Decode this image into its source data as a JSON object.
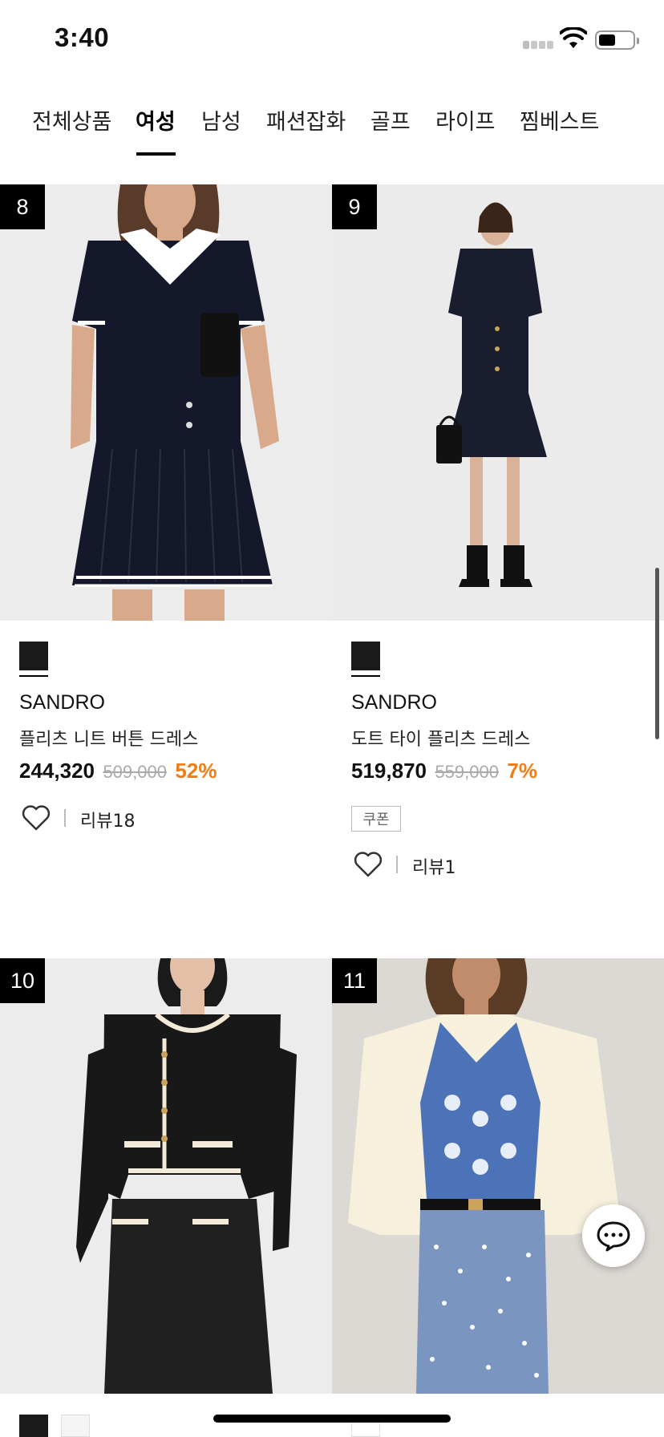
{
  "status_bar": {
    "time": "3:40"
  },
  "tabs": [
    {
      "label": "전체상품"
    },
    {
      "label": "여성",
      "active": true
    },
    {
      "label": "남성"
    },
    {
      "label": "패션잡화"
    },
    {
      "label": "골프"
    },
    {
      "label": "라이프"
    },
    {
      "label": "찜베스트"
    }
  ],
  "products": [
    {
      "rank": "8",
      "brand": "SANDRO",
      "name": "플리츠 니트 버튼 드레스",
      "price": "244,320",
      "original_price": "509,000",
      "discount": "52%",
      "reviews": "리뷰18"
    },
    {
      "rank": "9",
      "brand": "SANDRO",
      "name": "도트 타이 플리츠 드레스",
      "price": "519,870",
      "original_price": "559,000",
      "discount": "7%",
      "coupon": "쿠폰",
      "reviews": "리뷰1"
    },
    {
      "rank": "10"
    },
    {
      "rank": "11"
    }
  ],
  "colors": {
    "accent_discount": "#ef7d1a"
  }
}
